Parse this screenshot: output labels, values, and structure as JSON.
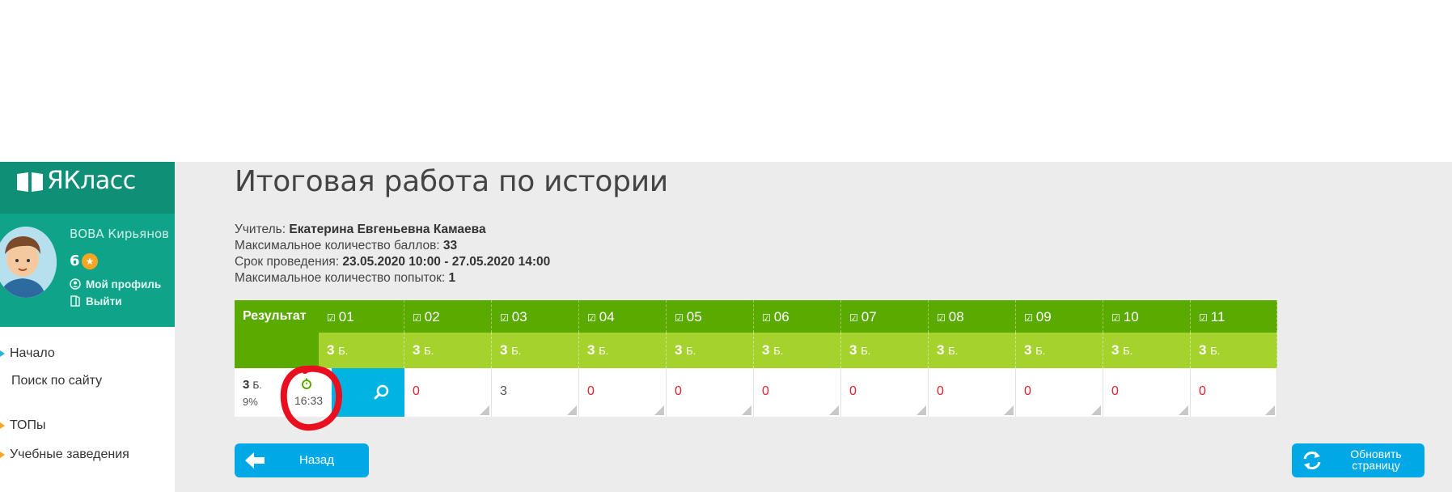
{
  "brand": {
    "name": "ЯКласс"
  },
  "profile": {
    "user_name": "ВОВА Кирьянов",
    "score": "6",
    "links": {
      "profile": "Мой профиль",
      "logout": "Выйти"
    }
  },
  "nav": {
    "items": [
      "Начало",
      "Поиск по сайту",
      "ТОПы",
      "Учебные заведения"
    ]
  },
  "page": {
    "title": "Итоговая работа по истории",
    "teacher_label": "Учитель:",
    "teacher": "Екатерина Евгеньевна Камаева",
    "max_points_label": "Максимальное количество баллов:",
    "max_points": "33",
    "period_label": "Срок проведения:",
    "period": "23.05.2020 10:00 - 27.05.2020 14:00",
    "attempts_label": "Максимальное количество попыток:",
    "attempts": "1"
  },
  "table": {
    "result_header": "Результат",
    "result_points": "3",
    "result_points_unit": "Б.",
    "result_percent": "9%",
    "result_time": "16:33",
    "points_unit": "Б.",
    "tasks": [
      {
        "num": "01",
        "points": "3",
        "value": "0"
      },
      {
        "num": "02",
        "points": "3",
        "value": "0"
      },
      {
        "num": "03",
        "points": "3",
        "value": "3"
      },
      {
        "num": "04",
        "points": "3",
        "value": "0"
      },
      {
        "num": "05",
        "points": "3",
        "value": "0"
      },
      {
        "num": "06",
        "points": "3",
        "value": "0"
      },
      {
        "num": "07",
        "points": "3",
        "value": "0"
      },
      {
        "num": "08",
        "points": "3",
        "value": "0"
      },
      {
        "num": "09",
        "points": "3",
        "value": "0"
      },
      {
        "num": "10",
        "points": "3",
        "value": "0"
      },
      {
        "num": "11",
        "points": "3",
        "value": "0"
      }
    ]
  },
  "buttons": {
    "back": "Назад",
    "refresh_line1": "Обновить",
    "refresh_line2": "страницу"
  },
  "colors": {
    "brand": "#0e8f76",
    "profile_bg": "#0fa38a",
    "header_green": "#5aaa00",
    "points_green": "#a6d22d",
    "accent_blue": "#00a8e6",
    "search_blue": "#00b3e3",
    "wrong_red": "#e0202a",
    "annotation_red": "#e8101e"
  }
}
